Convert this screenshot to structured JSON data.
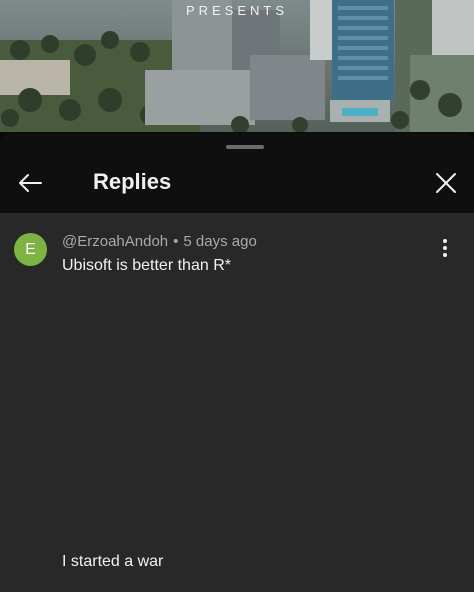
{
  "video": {
    "overlay_text": "PRESENTS"
  },
  "panel": {
    "title": "Replies",
    "back_icon": "arrow-left-icon",
    "close_icon": "close-icon"
  },
  "comment": {
    "avatar_letter": "E",
    "avatar_color": "#7cb342",
    "author": "@ErzoahAndoh",
    "separator": "•",
    "time": "5 days ago",
    "text": "Ubisoft is better than R*",
    "menu_icon": "more-vertical-icon"
  },
  "caption": "I started a war"
}
